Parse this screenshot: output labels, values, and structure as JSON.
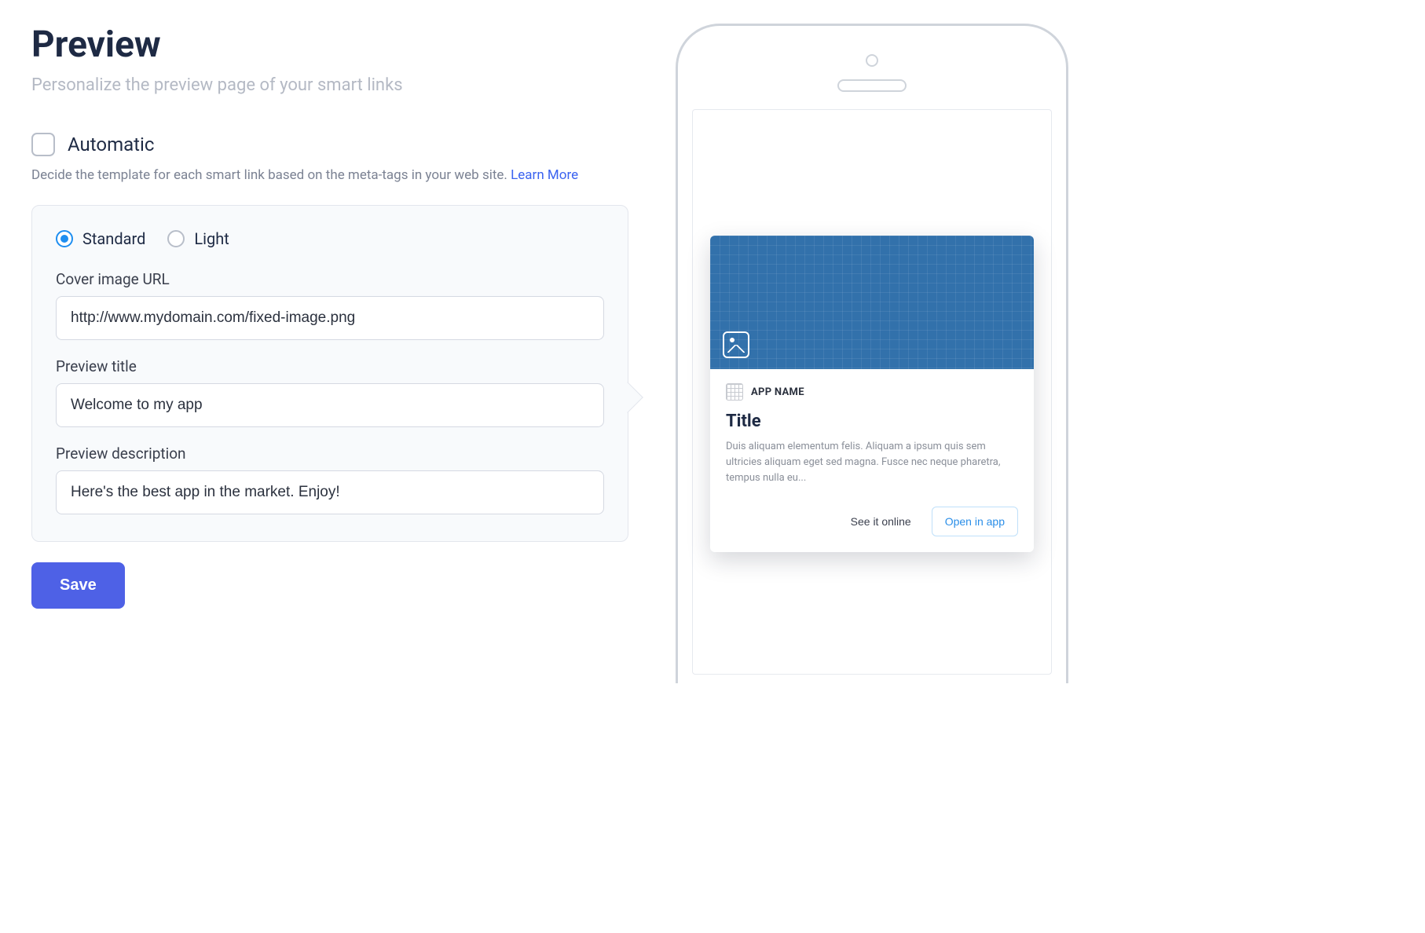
{
  "header": {
    "title": "Preview",
    "subtitle": "Personalize the preview page of your smart links"
  },
  "automatic": {
    "checked": false,
    "label": "Automatic",
    "help_text": "Decide the template for each smart link based on the meta-tags in your web site. ",
    "learn_more": "Learn More"
  },
  "template": {
    "options": {
      "standard": "Standard",
      "light": "Light"
    },
    "selected": "standard"
  },
  "fields": {
    "cover_url": {
      "label": "Cover image URL",
      "value": "http://www.mydomain.com/fixed-image.png"
    },
    "preview_title": {
      "label": "Preview title",
      "value": "Welcome to my app"
    },
    "preview_description": {
      "label": "Preview description",
      "value": "Here's the best app in the market. Enjoy!"
    }
  },
  "actions": {
    "save": "Save"
  },
  "phone_preview": {
    "app_name": "APP NAME",
    "title": "Title",
    "description": "Duis aliquam elementum felis. Aliquam a ipsum quis sem ultricies aliquam eget sed magna. Fusce nec neque pharetra, tempus nulla eu...",
    "see_online": "See it online",
    "open_in_app": "Open in app"
  }
}
